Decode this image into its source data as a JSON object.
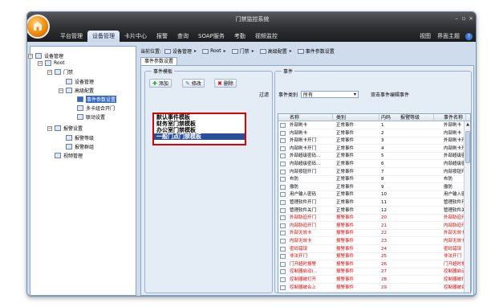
{
  "app": {
    "title": "门禁监控系统",
    "menu": [
      "平台管理",
      "设备管理",
      "卡片中心",
      "报警",
      "查询",
      "SOAP服务",
      "考勤",
      "视频监控"
    ],
    "active_menu": 1,
    "right_menu": [
      "视图",
      "界面主题"
    ],
    "help": "?",
    "window_buttons": [
      "–",
      "▫",
      "×"
    ]
  },
  "tree": [
    {
      "label": "设备管理",
      "icon": "computer-icon"
    },
    {
      "label": "Root",
      "icon": "root-icon"
    },
    {
      "label": "门禁",
      "icon": "door-icon"
    },
    {
      "label": "设备管理",
      "icon": "device-icon"
    },
    {
      "label": "高级配置",
      "icon": "config-icon"
    },
    {
      "label": "事件参数设置",
      "icon": "event-icon"
    },
    {
      "label": "多卡组合开门",
      "icon": "card-icon"
    },
    {
      "label": "联动设置",
      "icon": "link-icon"
    },
    {
      "label": "报警设置",
      "icon": "alarm-icon"
    },
    {
      "label": "报警等级",
      "icon": "level-icon"
    },
    {
      "label": "报警群组",
      "icon": "group-icon"
    },
    {
      "label": "视频管理",
      "icon": "video-icon"
    }
  ],
  "breadcrumb": {
    "prefix": "当前位置:",
    "items": [
      "设备管理",
      "Root",
      "门禁",
      "高级配置",
      "事件参数设置"
    ]
  },
  "tab": "事件参数设置",
  "template_panel": {
    "title": "事件模板",
    "buttons": {
      "add": "添加",
      "edit": "修改",
      "delete": "删除"
    },
    "items": [
      "默认事件模板",
      "财务室门禁模板",
      "办公室门禁模板",
      "一般门点门禁模板"
    ],
    "selected": 3
  },
  "event_panel": {
    "title": "事件",
    "filter_label": "过滤",
    "type_label": "事件类别",
    "type_value": "所有",
    "hint": "双击事件编辑事件",
    "columns": [
      "名称",
      "类别",
      "内码",
      "报警等级",
      "事件名称"
    ],
    "rows": [
      {
        "name": "外部刷卡",
        "type": "正常事件",
        "code": "1",
        "level": "",
        "event": "外部刷卡",
        "red": false
      },
      {
        "name": "内部刷卡",
        "type": "正常事件",
        "code": "2",
        "level": "",
        "event": "内部刷卡",
        "red": false
      },
      {
        "name": "外部刷卡开门",
        "type": "正常事件",
        "code": "3",
        "level": "",
        "event": "外部刷卡开门",
        "red": false
      },
      {
        "name": "内部刷卡开门",
        "type": "正常事件",
        "code": "4",
        "level": "",
        "event": "内部刷卡开门",
        "red": false
      },
      {
        "name": "外部超级密码...",
        "type": "正常事件",
        "code": "5",
        "level": "",
        "event": "外部超级密码",
        "red": false
      },
      {
        "name": "内部超级密码...",
        "type": "正常事件",
        "code": "6",
        "level": "",
        "event": "内部超级密码",
        "red": false
      },
      {
        "name": "内部按钮开门",
        "type": "正常事件",
        "code": "7",
        "level": "",
        "event": "内部按钮开门",
        "red": false
      },
      {
        "name": "布防",
        "type": "正常事件",
        "code": "8",
        "level": "",
        "event": "布防",
        "red": false
      },
      {
        "name": "撤防",
        "type": "正常事件",
        "code": "9",
        "level": "",
        "event": "撤防",
        "red": false
      },
      {
        "name": "用户输入密码",
        "type": "正常事件",
        "code": "10",
        "level": "",
        "event": "用户输入密码",
        "red": false
      },
      {
        "name": "管理软件开门",
        "type": "正常事件",
        "code": "11",
        "level": "",
        "event": "管理软件开门",
        "red": false
      },
      {
        "name": "管理软件关门",
        "type": "正常事件",
        "code": "12",
        "level": "",
        "event": "管理软件关门",
        "red": false
      },
      {
        "name": "外部胁迫开门",
        "type": "报警事件",
        "code": "20",
        "level": "",
        "event": "外部胁迫开门",
        "red": true
      },
      {
        "name": "内部胁迫开门",
        "type": "报警事件",
        "code": "21",
        "level": "",
        "event": "内部胁迫开门",
        "red": true
      },
      {
        "name": "外部无效卡",
        "type": "报警事件",
        "code": "22",
        "level": "",
        "event": "外部无效卡",
        "red": true
      },
      {
        "name": "内部无效卡",
        "type": "报警事件",
        "code": "23",
        "level": "",
        "event": "内部无效卡",
        "red": true
      },
      {
        "name": "密码错误",
        "type": "报警事件",
        "code": "24",
        "level": "",
        "event": "密码错误",
        "red": true
      },
      {
        "name": "非法开门",
        "type": "报警事件",
        "code": "25",
        "level": "",
        "event": "非法开门",
        "red": true
      },
      {
        "name": "门开超时报警",
        "type": "报警事件",
        "code": "26",
        "level": "",
        "event": "门开超时报警",
        "red": true
      },
      {
        "name": "控制器启动(...",
        "type": "报警事件",
        "code": "27",
        "level": "",
        "event": "控制器启动(...",
        "red": true
      },
      {
        "name": "控制器被打开",
        "type": "报警事件",
        "code": "28",
        "level": "",
        "event": "控制器被打开",
        "red": true
      },
      {
        "name": "控制器被合上",
        "type": "报警事件",
        "code": "29",
        "level": "",
        "event": "控制器被合上",
        "red": true
      }
    ]
  },
  "colors": {
    "alarm_text": "#e00000",
    "selection": "#2b4e9a",
    "highlight_border": "#e00000"
  }
}
